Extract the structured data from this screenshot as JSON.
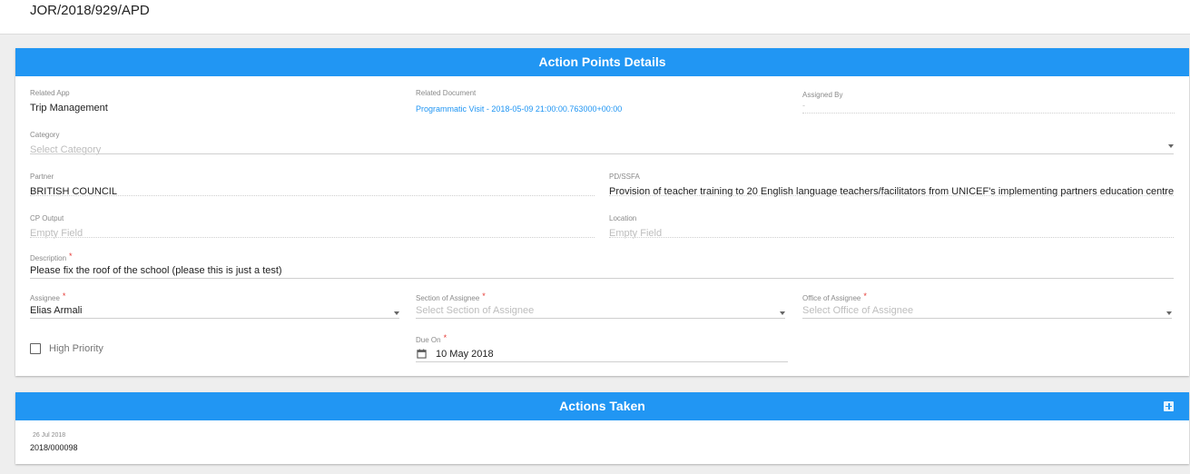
{
  "header": {
    "reference": "JOR/2018/929/APD"
  },
  "details": {
    "title": "Action Points Details",
    "related_app": {
      "label": "Related App",
      "value": "Trip Management"
    },
    "related_document": {
      "label": "Related Document",
      "value": "Programmatic Visit - 2018-05-09 21:00:00.763000+00:00"
    },
    "assigned_by": {
      "label": "Assigned By",
      "value": "-"
    },
    "category": {
      "label": "Category",
      "placeholder": "Select Category"
    },
    "partner": {
      "label": "Partner",
      "value": "BRITISH COUNCIL"
    },
    "pd_ssfa": {
      "label": "PD/SSFA",
      "value": "Provision of teacher training to 20 English language teachers/facilitators from UNICEF's implementing partners education centres, MoE"
    },
    "cp_output": {
      "label": "CP Output",
      "placeholder": "Empty Field"
    },
    "location": {
      "label": "Location",
      "placeholder": "Empty Field"
    },
    "description": {
      "label": "Description",
      "value": "Please fix the roof of the school (please this is just a test)"
    },
    "assignee": {
      "label": "Assignee",
      "value": "Elias Armali"
    },
    "section": {
      "label": "Section of Assignee",
      "placeholder": "Select Section of Assignee"
    },
    "office": {
      "label": "Office of Assignee",
      "placeholder": "Select Office of Assignee"
    },
    "high_priority": {
      "label": "High Priority",
      "checked": false
    },
    "due_on": {
      "label": "Due On",
      "value": "10 May 2018"
    },
    "required_mark": "*"
  },
  "actions": {
    "title": "Actions Taken",
    "items": [
      {
        "date": "26 Jul 2018",
        "reference": "2018/000098"
      }
    ]
  },
  "colors": {
    "accent": "#2196f3",
    "required": "#e53935",
    "background": "#eeeeee"
  },
  "icons": {
    "dropdown": "chevron-down-icon",
    "calendar": "calendar-icon",
    "add": "add-box-icon"
  }
}
